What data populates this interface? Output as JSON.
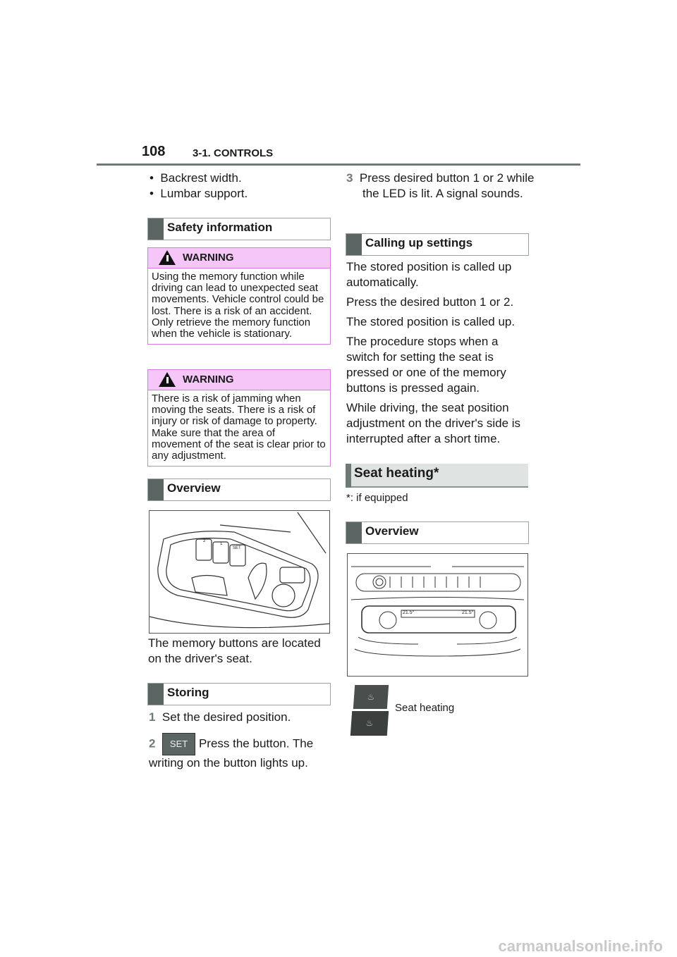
{
  "header": {
    "page_number": "108",
    "chapter": "3-1. CONTROLS"
  },
  "left": {
    "bullets": [
      "Backrest width.",
      "Lumbar support."
    ],
    "safety_heading": "Safety information",
    "warning1": {
      "label": "WARNING",
      "text": "Using the memory function while driving can lead to unexpected seat movements. Vehicle control could be lost. There is a risk of an accident. Only retrieve the memory function when the vehicle is stationary."
    },
    "warning2": {
      "label": "WARNING",
      "text": "There is a risk of jamming when moving the seats. There is a risk of injury or risk of damage to property. Make sure that the area of movement of the seat is clear prior to any adjustment."
    },
    "overview_heading": "Overview",
    "figure_labels": [
      "2",
      "1",
      "SET"
    ],
    "caption": "The memory buttons are located on the driver's seat.",
    "storing_heading": "Storing",
    "steps": [
      {
        "n": "1",
        "text": "Set the desired position."
      },
      {
        "n": "2",
        "button": "SET",
        "text": "Press the button. The writing on the button lights up."
      }
    ]
  },
  "right": {
    "step3": {
      "n": "3",
      "text": "Press desired button 1 or 2 while the LED is lit. A signal sounds."
    },
    "calling_heading": "Calling up settings",
    "paragraphs": [
      "The stored position is called up automatically.",
      "Press the desired button 1 or 2.",
      "The stored position is called up.",
      "The procedure stops when a switch for setting the seat is pressed or one of the memory buttons is pressed again.",
      "While driving, the seat position adjustment on the driver's side is interrupted after a short time."
    ],
    "section_heading": "Seat heating*",
    "footnote": "*: if equipped",
    "overview_heading": "Overview",
    "panel_temps": [
      "21.5°",
      "21.5°"
    ],
    "seat_heating_label": "Seat heating"
  },
  "watermark": "carmanualsonline.info"
}
